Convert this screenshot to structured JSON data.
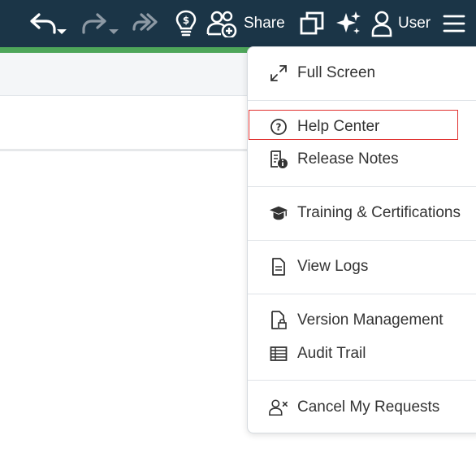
{
  "toolbar": {
    "undo_icon": "undo-icon",
    "redo_icon": "redo-icon",
    "forward_icon": "double-forward-icon",
    "insight_icon": "lightbulb-dollar-icon",
    "share_label": "Share",
    "window_icon": "window-copy-icon",
    "ai_icon": "sparkle-icon",
    "user_label": "User",
    "menu_icon": "hamburger-menu-icon",
    "background_color": "#1b3547",
    "accent_strip_color": "#4ea65a"
  },
  "menu": {
    "items": [
      {
        "label": "Full Screen",
        "icon": "expand-arrows-icon"
      },
      {
        "label": "Help Center",
        "icon": "question-circle-icon",
        "highlighted": true
      },
      {
        "label": "Release Notes",
        "icon": "document-info-icon"
      },
      {
        "label": "Training & Certifications",
        "icon": "graduation-cap-icon"
      },
      {
        "label": "View Logs",
        "icon": "log-file-icon"
      },
      {
        "label": "Version Management",
        "icon": "document-lock-icon"
      },
      {
        "label": "Audit Trail",
        "icon": "table-grid-icon"
      },
      {
        "label": "Cancel My Requests",
        "icon": "user-cancel-icon"
      }
    ],
    "highlight_color": "#e0302e"
  }
}
